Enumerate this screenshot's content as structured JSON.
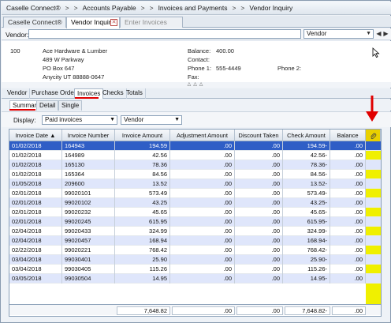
{
  "breadcrumb": [
    "Caselle Connect®",
    ">",
    ">",
    "Accounts Payable",
    ">",
    ">",
    "Invoices and Payments",
    ">",
    ">",
    "Vendor Inquiry"
  ],
  "tabs": [
    {
      "label": "Caselle Connect®"
    },
    {
      "label": "Vendor Inquiry"
    },
    {
      "label": "Enter Invoices"
    }
  ],
  "vendor_search": {
    "label": "Vendor:",
    "value": "",
    "mode": "Vendor"
  },
  "vendor": {
    "number": "100",
    "name": "Ace Hardware & Lumber",
    "address1": "489 W Parkway",
    "address2": "PO Box 647",
    "city": "Anycity UT 88888-0647",
    "balance_label": "Balance:",
    "balance": "400.00",
    "contact_label": "Contact:",
    "phone1_label": "Phone 1:",
    "phone1": "555-4449",
    "phone2_label": "Phone 2:",
    "fax_label": "Fax:"
  },
  "section_tabs": [
    "Vendor",
    "Purchase Orders",
    "Invoices",
    "Checks",
    "Totals"
  ],
  "sub_tabs": [
    "Summary",
    "Detail",
    "Single"
  ],
  "display": {
    "label": "Display:",
    "filter": "Paid invoices",
    "mode": "Vendor"
  },
  "grid": {
    "columns": [
      "Invoice Date",
      "Invoice Number",
      "Invoice Amount",
      "Adjustment Amount",
      "Discount Taken",
      "Check Amount",
      "Balance"
    ],
    "rows": [
      [
        "01/02/2018",
        "164943",
        "194.59",
        ".00",
        ".00",
        "194.59-",
        ".00"
      ],
      [
        "01/02/2018",
        "164989",
        "42.56",
        ".00",
        ".00",
        "42.56-",
        ".00"
      ],
      [
        "01/02/2018",
        "165130",
        "78.36",
        ".00",
        ".00",
        "78.36-",
        ".00"
      ],
      [
        "01/02/2018",
        "165364",
        "84.56",
        ".00",
        ".00",
        "84.56-",
        ".00"
      ],
      [
        "01/05/2018",
        "209600",
        "13.52",
        ".00",
        ".00",
        "13.52-",
        ".00"
      ],
      [
        "02/01/2018",
        "99020101",
        "573.49",
        ".00",
        ".00",
        "573.49-",
        ".00"
      ],
      [
        "02/01/2018",
        "99020102",
        "43.25",
        ".00",
        ".00",
        "43.25-",
        ".00"
      ],
      [
        "02/01/2018",
        "99020232",
        "45.65",
        ".00",
        ".00",
        "45.65-",
        ".00"
      ],
      [
        "02/01/2018",
        "99020245",
        "615.95",
        ".00",
        ".00",
        "615.95-",
        ".00"
      ],
      [
        "02/04/2018",
        "99020433",
        "324.99",
        ".00",
        ".00",
        "324.99-",
        ".00"
      ],
      [
        "02/04/2018",
        "99020457",
        "168.94",
        ".00",
        ".00",
        "168.94-",
        ".00"
      ],
      [
        "02/22/2018",
        "99020221",
        "768.42",
        ".00",
        ".00",
        "768.42-",
        ".00"
      ],
      [
        "03/04/2018",
        "99030401",
        "25.90",
        ".00",
        ".00",
        "25.90-",
        ".00"
      ],
      [
        "03/04/2018",
        "99030405",
        "115.26",
        ".00",
        ".00",
        "115.26-",
        ".00"
      ],
      [
        "03/05/2018",
        "99030504",
        "14.95",
        ".00",
        ".00",
        "14.95-",
        ".00"
      ]
    ],
    "totals": {
      "invoice_amount": "7,648.82",
      "adjustment": ".00",
      "discount": ".00",
      "check_amount": "7,648.82-",
      "balance": ".00"
    }
  },
  "colors": {
    "selected_row": "#2f5ec6",
    "alt_row": "#dfe6fb",
    "highlight_column": "#f0f000",
    "annotation": "#e00000"
  }
}
